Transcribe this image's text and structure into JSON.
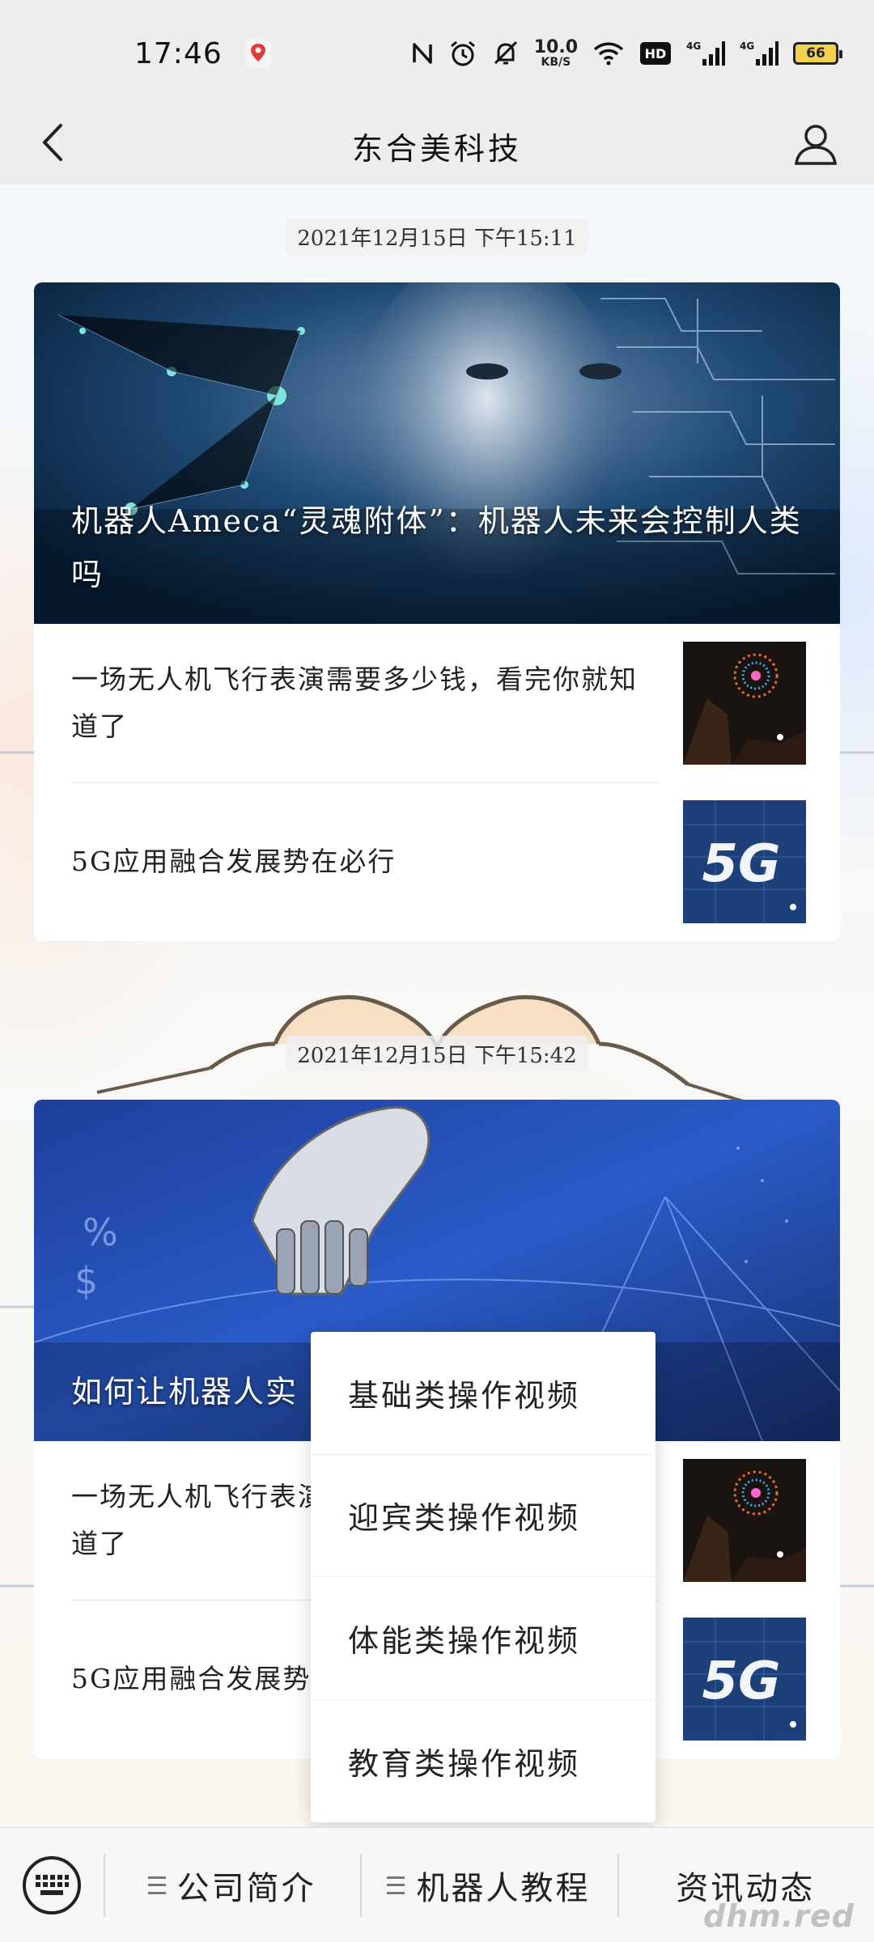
{
  "status_bar": {
    "time": "17:46",
    "net_speed_value": "10.0",
    "net_speed_unit": "KB/S",
    "network_1": "4G",
    "network_2": "4G",
    "battery_level": "66",
    "icons": [
      "location-pin-icon",
      "nfc-icon",
      "alarm-icon",
      "mute-bell-icon",
      "wifi-icon",
      "hd-icon",
      "signal-icon",
      "battery-icon"
    ]
  },
  "nav": {
    "title": "东合美科技",
    "back_icon": "chevron-left-icon",
    "profile_icon": "person-icon"
  },
  "messages": [
    {
      "timestamp": "2021年12月15日 下午15:11",
      "headline": "机器人Ameca“灵魂附体”：机器人未来会控制人类吗",
      "items": [
        {
          "text": "一场无人机飞行表演需要多少钱，看完你就知道了",
          "thumb": "drone-fireworks-thumbnail"
        },
        {
          "text": "5G应用融合发展势在必行",
          "thumb": "5g-thumbnail"
        }
      ]
    },
    {
      "timestamp": "2021年12月15日 下午15:42",
      "headline": "如何让机器人实",
      "items": [
        {
          "text": "一场无人机飞行表演需要多少钱，看完你就知道了",
          "thumb": "drone-fireworks-thumbnail"
        },
        {
          "text": "5G应用融合发展势在必行",
          "thumb": "5g-thumbnail"
        }
      ]
    }
  ],
  "popup_menu": [
    "基础类操作视频",
    "迎宾类操作视频",
    "体能类操作视频",
    "教育类操作视频"
  ],
  "bottom_bar": {
    "keyboard_icon": "keyboard-icon",
    "tabs": [
      "公司简介",
      "机器人教程",
      "资讯动态"
    ]
  },
  "watermark": "dhm.red",
  "colors": {
    "bar_bg": "#ededed",
    "battery": "#f2d24e",
    "card_bg": "#ffffff"
  }
}
